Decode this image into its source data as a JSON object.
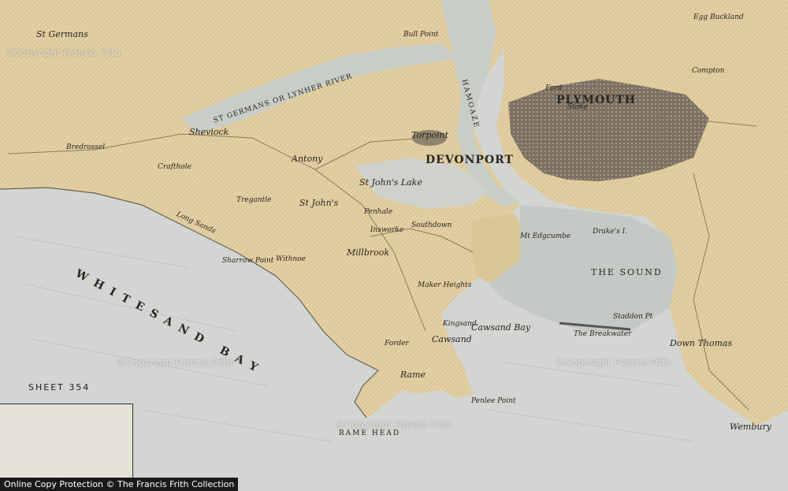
{
  "footer": {
    "text": "Online Copy Protection © The Francis Frith Collection"
  },
  "sheet": {
    "label": "SHEET 354"
  },
  "watermarks": [
    "©Copyright Francis Frith",
    "©Copyright Francis Frith",
    "©Copyright Francis Frith",
    "©Copyright Francis Frith"
  ],
  "places": {
    "plymouth": "PLYMOUTH",
    "devonport": "DEVONPORT",
    "torpoint": "Torpoint",
    "antony": "Antony",
    "st_johns": "St John's",
    "st_johns_lake": "St John's Lake",
    "millbrook": "Millbrook",
    "rame": "Rame",
    "rame_head": "RAME HEAD",
    "cawsand": "Cawsand",
    "cawsand_bay": "Cawsand Bay",
    "kingsand": "Kingsand",
    "the_sound": "THE SOUND",
    "the_breakwater": "The Breakwater",
    "whitesand_bay": "WHITESAND BAY",
    "st_germans": "St Germans",
    "sheviock": "Sheviock",
    "crafthole": "Crafthole",
    "bredrossel": "Bredrossel",
    "penhale": "Penhale",
    "southdown": "Southdown",
    "mt_edgcumbe": "Mt Edgcumbe",
    "forder": "Forder",
    "penlee_point": "Penlee Point",
    "down_thomas": "Down Thomas",
    "wembury": "Wembury",
    "stoke": "Stoke",
    "ford": "Ford",
    "compton": "Compton",
    "egg_buckland": "Egg Buckland",
    "hamoaze": "HAMOAZE",
    "st_germans_river": "ST GERMANS or LYNHER RIVER",
    "long_sands": "Long Sands",
    "tregantle": "Tregantle",
    "withnoe": "Withnoe",
    "maker_heights": "Maker Heights",
    "drakes_i": "Drake's I.",
    "bull_point": "Bull Point",
    "sharrow_point": "Sharrow Point",
    "insworke": "Insworke",
    "staddon_pt": "Staddon Pt"
  }
}
